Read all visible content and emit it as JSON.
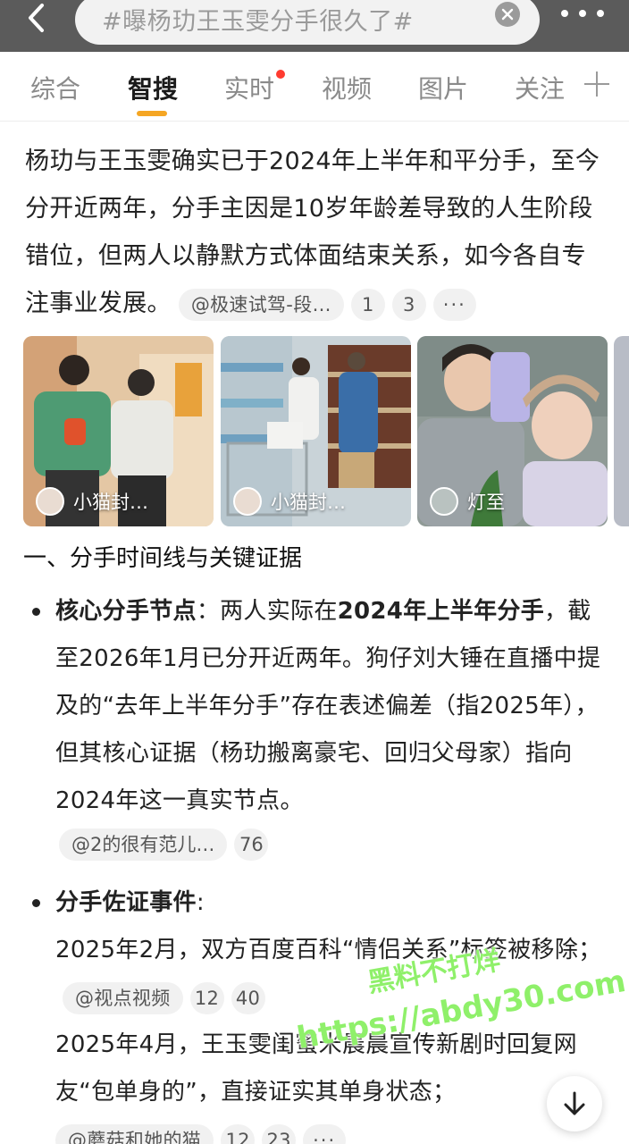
{
  "search": {
    "query": "#曝杨玏王玉雯分手很久了#"
  },
  "tabs": [
    {
      "label": "综合"
    },
    {
      "label": "智搜"
    },
    {
      "label": "实时"
    },
    {
      "label": "视频"
    },
    {
      "label": "图片"
    },
    {
      "label": "关注"
    }
  ],
  "summary": {
    "text": "杨玏与王玉雯确实已于2024年上半年和平分手，至今分开近两年，分手主因是10岁年龄差导致的人生阶段错位，但两人以静默方式体面结束关系，如今各自专注事业发展。",
    "source": "@极速试驾-段…",
    "ref1": "1",
    "ref2": "3",
    "more": "···"
  },
  "images": [
    {
      "credit": "小猫封…"
    },
    {
      "credit": "小猫封…"
    },
    {
      "credit": "灯至"
    }
  ],
  "section1": {
    "title": "一、分手时间线与关键证据",
    "bullet1": {
      "label": "核心分手节点",
      "text_a": "：两人实际在",
      "bold_a": "2024年上半年分手",
      "text_b": "，截至2026年1月已分开近两年。狗仔刘大锤在直播中提及的“去年上半年分手”存在表述偏差（指2025年），但其核心证据（杨玏搬离豪宅、回归父母家）指向2024年这一真实节点。",
      "source": "@2的很有范儿…",
      "ref": "76"
    },
    "bullet2": {
      "label": "分手佐证事件",
      "colon": ":",
      "line1": "2025年2月，双方百度百科“情侣关系”标签被移除；",
      "line1_source": "@视点视频",
      "line1_ref1": "12",
      "line1_ref2": "40",
      "line2": "2025年4月，王玉雯闺蜜米晨晨宣传新剧时回复网友“包单身的”，直接证实其单身状态；",
      "line2_source": "@蘑菇和她的猫",
      "line2_ref1": "12",
      "line2_ref2": "23",
      "line2_more": "···"
    }
  },
  "watermark": {
    "line1": "黑料不打烊",
    "line2": "https://abdy30.com"
  },
  "icons": {
    "back": "chevron-left-icon",
    "clear": "close-circle-icon",
    "more": "more-dots-icon",
    "add_tab": "plus-icon",
    "scroll_down": "arrow-down-icon"
  },
  "colors": {
    "accent": "#f5a623",
    "notification_dot": "#ff3b30",
    "watermark": "#8ff06a"
  }
}
